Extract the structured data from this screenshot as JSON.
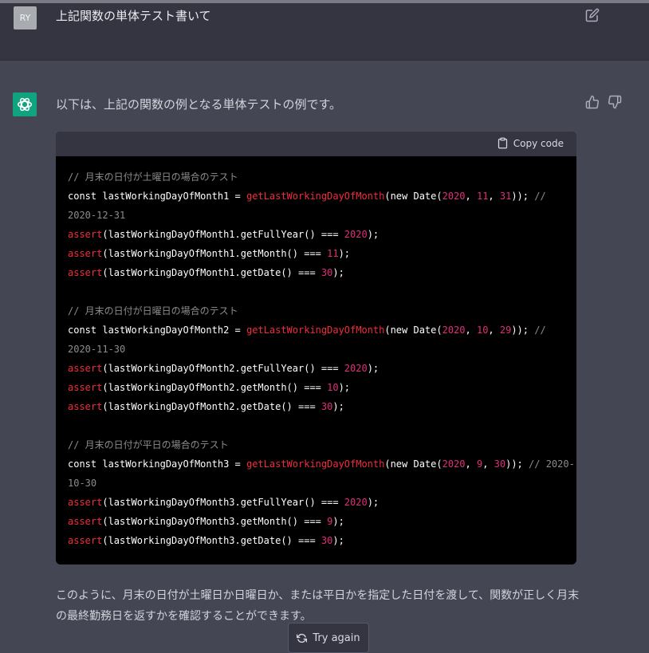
{
  "user_message": {
    "avatar_initials": "RY",
    "text": "上記関数の単体テスト書いて"
  },
  "assistant_message": {
    "intro": "以下は、上記の関数の例となる単体テストの例です。",
    "code_header": {
      "copy_label": "Copy code"
    },
    "code_lines": [
      [
        {
          "t": "comment",
          "v": "// 月末の日付が土曜日の場合のテスト"
        }
      ],
      [
        {
          "t": "plain",
          "v": "const lastWorkingDayOfMonth1 = "
        },
        {
          "t": "fn",
          "v": "getLastWorkingDayOfMonth"
        },
        {
          "t": "plain",
          "v": "(new Date("
        },
        {
          "t": "num",
          "v": "2020"
        },
        {
          "t": "plain",
          "v": ", "
        },
        {
          "t": "num",
          "v": "11"
        },
        {
          "t": "plain",
          "v": ", "
        },
        {
          "t": "num",
          "v": "31"
        },
        {
          "t": "plain",
          "v": ")); "
        },
        {
          "t": "comment",
          "v": "//"
        }
      ],
      [
        {
          "t": "comment",
          "v": "2020-12-31"
        }
      ],
      [
        {
          "t": "fn",
          "v": "assert"
        },
        {
          "t": "plain",
          "v": "(lastWorkingDayOfMonth1.getFullYear() === "
        },
        {
          "t": "num",
          "v": "2020"
        },
        {
          "t": "plain",
          "v": ");"
        }
      ],
      [
        {
          "t": "fn",
          "v": "assert"
        },
        {
          "t": "plain",
          "v": "(lastWorkingDayOfMonth1.getMonth() === "
        },
        {
          "t": "num",
          "v": "11"
        },
        {
          "t": "plain",
          "v": ");"
        }
      ],
      [
        {
          "t": "fn",
          "v": "assert"
        },
        {
          "t": "plain",
          "v": "(lastWorkingDayOfMonth1.getDate() === "
        },
        {
          "t": "num",
          "v": "30"
        },
        {
          "t": "plain",
          "v": ");"
        }
      ],
      [],
      [
        {
          "t": "comment",
          "v": "// 月末の日付が日曜日の場合のテスト"
        }
      ],
      [
        {
          "t": "plain",
          "v": "const lastWorkingDayOfMonth2 = "
        },
        {
          "t": "fn",
          "v": "getLastWorkingDayOfMonth"
        },
        {
          "t": "plain",
          "v": "(new Date("
        },
        {
          "t": "num",
          "v": "2020"
        },
        {
          "t": "plain",
          "v": ", "
        },
        {
          "t": "num",
          "v": "10"
        },
        {
          "t": "plain",
          "v": ", "
        },
        {
          "t": "num",
          "v": "29"
        },
        {
          "t": "plain",
          "v": ")); "
        },
        {
          "t": "comment",
          "v": "//"
        }
      ],
      [
        {
          "t": "comment",
          "v": "2020-11-30"
        }
      ],
      [
        {
          "t": "fn",
          "v": "assert"
        },
        {
          "t": "plain",
          "v": "(lastWorkingDayOfMonth2.getFullYear() === "
        },
        {
          "t": "num",
          "v": "2020"
        },
        {
          "t": "plain",
          "v": ");"
        }
      ],
      [
        {
          "t": "fn",
          "v": "assert"
        },
        {
          "t": "plain",
          "v": "(lastWorkingDayOfMonth2.getMonth() === "
        },
        {
          "t": "num",
          "v": "10"
        },
        {
          "t": "plain",
          "v": ");"
        }
      ],
      [
        {
          "t": "fn",
          "v": "assert"
        },
        {
          "t": "plain",
          "v": "(lastWorkingDayOfMonth2.getDate() === "
        },
        {
          "t": "num",
          "v": "30"
        },
        {
          "t": "plain",
          "v": ");"
        }
      ],
      [],
      [
        {
          "t": "comment",
          "v": "// 月末の日付が平日の場合のテスト"
        }
      ],
      [
        {
          "t": "plain",
          "v": "const lastWorkingDayOfMonth3 = "
        },
        {
          "t": "fn",
          "v": "getLastWorkingDayOfMonth"
        },
        {
          "t": "plain",
          "v": "(new Date("
        },
        {
          "t": "num",
          "v": "2020"
        },
        {
          "t": "plain",
          "v": ", "
        },
        {
          "t": "num",
          "v": "9"
        },
        {
          "t": "plain",
          "v": ", "
        },
        {
          "t": "num",
          "v": "30"
        },
        {
          "t": "plain",
          "v": ")); "
        },
        {
          "t": "comment",
          "v": "// 2020-"
        }
      ],
      [
        {
          "t": "comment",
          "v": "10-30"
        }
      ],
      [
        {
          "t": "fn",
          "v": "assert"
        },
        {
          "t": "plain",
          "v": "(lastWorkingDayOfMonth3.getFullYear() === "
        },
        {
          "t": "num",
          "v": "2020"
        },
        {
          "t": "plain",
          "v": ");"
        }
      ],
      [
        {
          "t": "fn",
          "v": "assert"
        },
        {
          "t": "plain",
          "v": "(lastWorkingDayOfMonth3.getMonth() === "
        },
        {
          "t": "num",
          "v": "9"
        },
        {
          "t": "plain",
          "v": ");"
        }
      ],
      [
        {
          "t": "fn",
          "v": "assert"
        },
        {
          "t": "plain",
          "v": "(lastWorkingDayOfMonth3.getDate() === "
        },
        {
          "t": "num",
          "v": "30"
        },
        {
          "t": "plain",
          "v": ");"
        }
      ]
    ],
    "outro": "このように、月末の日付が土曜日か日曜日か、または平日かを指定した日付を渡して、関数が正しく月末の最終勤務日を返すかを確認することができます。"
  },
  "controls": {
    "try_again_label": "Try again"
  },
  "icons": {
    "edit": "edit-icon",
    "thumbs_up": "thumbs-up-icon",
    "thumbs_down": "thumbs-down-icon",
    "clipboard": "clipboard-icon",
    "refresh": "refresh-icon",
    "assistant_logo": "assistant-logo-icon"
  },
  "colors": {
    "accent": "#10a37f",
    "code_function": "#f22c3d",
    "code_number": "#df3079",
    "code_comment": "#8c8c8c"
  }
}
